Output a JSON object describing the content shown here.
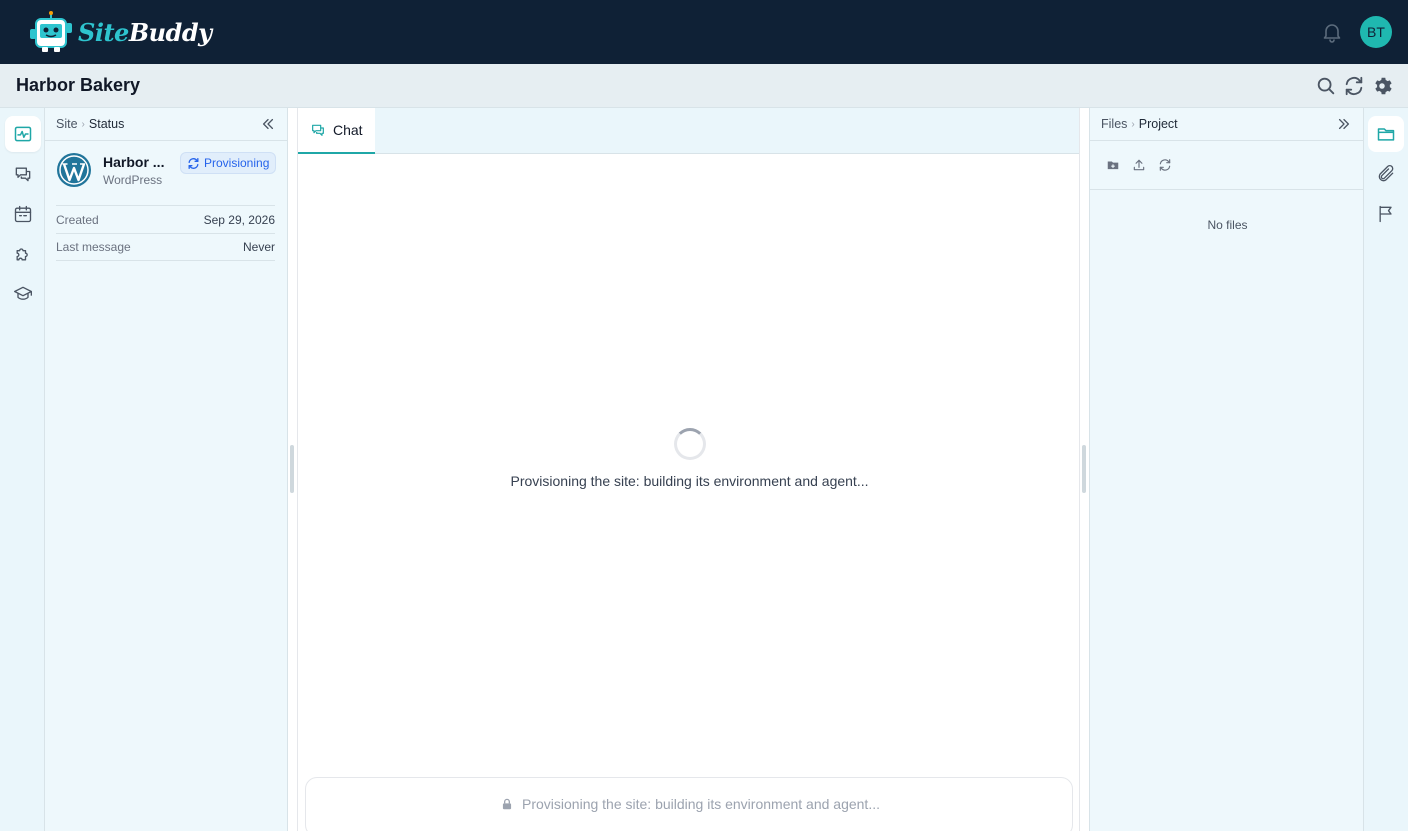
{
  "app": {
    "logo_site": "Site",
    "logo_buddy": "Buddy",
    "user_initials": "BT"
  },
  "header": {
    "title": "Harbor Bakery"
  },
  "status_panel": {
    "breadcrumb_root": "Site",
    "breadcrumb_current": "Status",
    "site_name": "Harbor ...",
    "site_type": "WordPress",
    "badge": "Provisioning",
    "meta": [
      {
        "label": "Created",
        "value": "Sep 29, 2026"
      },
      {
        "label": "Last message",
        "value": "Never"
      }
    ]
  },
  "chat": {
    "tab_label": "Chat",
    "loading_message": "Provisioning the site: building its environment and agent...",
    "input_placeholder": "Provisioning the site: building its environment and agent..."
  },
  "files_panel": {
    "breadcrumb_root": "Files",
    "breadcrumb_current": "Project",
    "empty_text": "No files"
  },
  "icons": {
    "left_rail": [
      "activity-icon",
      "chat-icon",
      "calendar-icon",
      "puzzle-icon",
      "graduation-cap-icon"
    ],
    "right_rail": [
      "folder-icon",
      "paperclip-icon",
      "flag-icon"
    ]
  },
  "colors": {
    "topbar": "#0f2136",
    "accent": "#1fa7a7",
    "badge_text": "#2563eb",
    "avatar": "#1fb8b0"
  }
}
